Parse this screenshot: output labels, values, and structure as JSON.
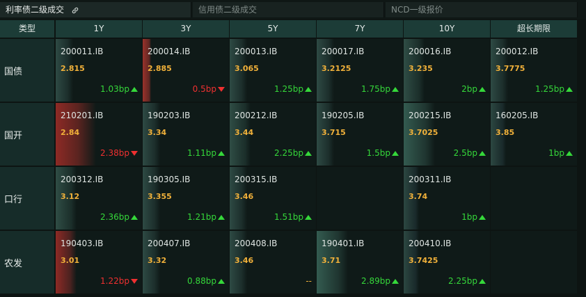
{
  "tabs": [
    {
      "label": "利率债二级成交",
      "active": true
    },
    {
      "label": "信用债二级成交",
      "active": false
    },
    {
      "label": "NCD一级报价",
      "active": false
    }
  ],
  "table": {
    "corner_label": "类型",
    "columns": [
      "1Y",
      "3Y",
      "5Y",
      "7Y",
      "10Y",
      "超长期限"
    ],
    "rows": [
      {
        "label": "国债",
        "cells": [
          {
            "code": "200011.IB",
            "yield": "2.815",
            "change": "1.03bp",
            "dir": "up"
          },
          {
            "code": "200014.IB",
            "yield": "2.885",
            "change": "0.5bp",
            "dir": "down"
          },
          {
            "code": "200013.IB",
            "yield": "3.065",
            "change": "1.25bp",
            "dir": "up"
          },
          {
            "code": "200017.IB",
            "yield": "3.2125",
            "change": "1.75bp",
            "dir": "up"
          },
          {
            "code": "200016.IB",
            "yield": "3.235",
            "change": "2bp",
            "dir": "up"
          },
          {
            "code": "200012.IB",
            "yield": "3.7775",
            "change": "1.25bp",
            "dir": "up"
          }
        ]
      },
      {
        "label": "国开",
        "cells": [
          {
            "code": "210201.IB",
            "yield": "2.84",
            "change": "2.38bp",
            "dir": "down"
          },
          {
            "code": "190203.IB",
            "yield": "3.34",
            "change": "1.11bp",
            "dir": "up"
          },
          {
            "code": "200212.IB",
            "yield": "3.44",
            "change": "2.25bp",
            "dir": "up"
          },
          {
            "code": "190205.IB",
            "yield": "3.715",
            "change": "1.5bp",
            "dir": "up"
          },
          {
            "code": "200215.IB",
            "yield": "3.7025",
            "change": "2.5bp",
            "dir": "up"
          },
          {
            "code": "160205.IB",
            "yield": "3.85",
            "change": "1bp",
            "dir": "up"
          }
        ]
      },
      {
        "label": "口行",
        "cells": [
          {
            "code": "200312.IB",
            "yield": "3.12",
            "change": "2.36bp",
            "dir": "up"
          },
          {
            "code": "190305.IB",
            "yield": "3.355",
            "change": "1.21bp",
            "dir": "up"
          },
          {
            "code": "200315.IB",
            "yield": "3.46",
            "change": "1.51bp",
            "dir": "up"
          },
          null,
          {
            "code": "200311.IB",
            "yield": "3.74",
            "change": "1bp",
            "dir": "up"
          },
          null
        ]
      },
      {
        "label": "农发",
        "cells": [
          {
            "code": "190403.IB",
            "yield": "3.01",
            "change": "1.22bp",
            "dir": "down"
          },
          {
            "code": "200407.IB",
            "yield": "3.32",
            "change": "0.88bp",
            "dir": "up"
          },
          {
            "code": "200408.IB",
            "yield": "3.46",
            "change": "--",
            "dir": "flat"
          },
          {
            "code": "190401.IB",
            "yield": "3.71",
            "change": "2.89bp",
            "dir": "up"
          },
          {
            "code": "200410.IB",
            "yield": "3.7425",
            "change": "2.25bp",
            "dir": "up"
          },
          null
        ]
      }
    ]
  },
  "colors": {
    "header_bg": "#1c3c37",
    "yield": "#f1b13a",
    "up": "#35d83a",
    "down": "#ef3030"
  }
}
